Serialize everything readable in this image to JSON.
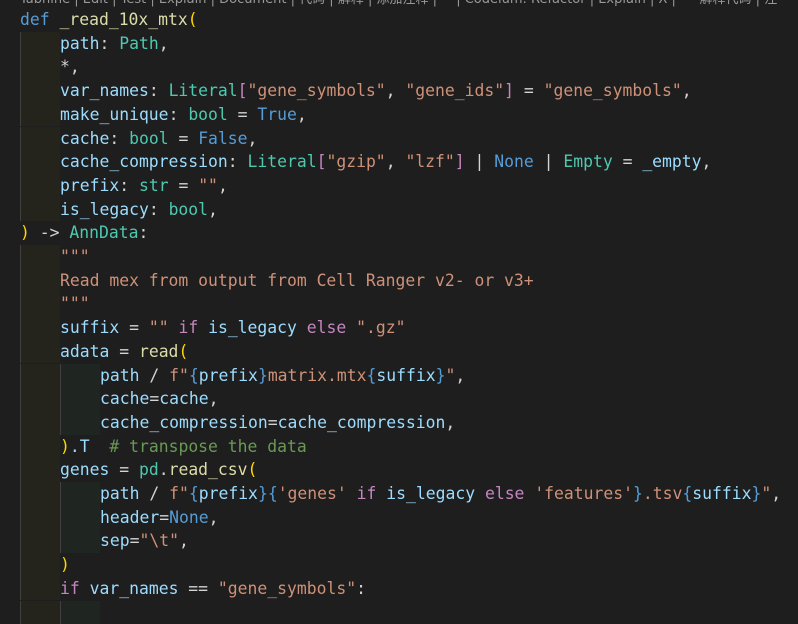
{
  "codelens": [
    "Tabnine",
    "Edit",
    "Test",
    "Explain",
    "Document",
    "代码",
    "解释",
    "添加注释",
    "^",
    "Codeium: Refactor",
    "Explain",
    "X",
    "***解释代码",
    "注"
  ],
  "colors": {
    "background": "#1e1e1e",
    "keyword": "#569cd6",
    "function": "#dcdcaa",
    "parameter": "#9cdcfe",
    "type": "#4ec9b0",
    "string": "#ce9178",
    "control": "#c586c0",
    "bracket": "#ffd700",
    "comment": "#6a9955"
  },
  "lines": [
    {
      "indent": 0,
      "tokens": [
        [
          "def",
          "kw"
        ],
        [
          " ",
          "plain"
        ],
        [
          "_read_10x_mtx",
          "fn"
        ],
        [
          "(",
          "bracket"
        ]
      ]
    },
    {
      "indent": 1,
      "tokens": [
        [
          "path",
          "param"
        ],
        [
          ": ",
          "plain"
        ],
        [
          "Path",
          "type"
        ],
        [
          ",",
          "plain"
        ]
      ]
    },
    {
      "indent": 1,
      "tokens": [
        [
          "*,",
          "plain"
        ]
      ]
    },
    {
      "indent": 1,
      "tokens": [
        [
          "var_names",
          "param"
        ],
        [
          ": ",
          "plain"
        ],
        [
          "Literal",
          "type"
        ],
        [
          "[",
          "ctrl"
        ],
        [
          "\"gene_symbols\"",
          "str"
        ],
        [
          ", ",
          "plain"
        ],
        [
          "\"gene_ids\"",
          "str"
        ],
        [
          "]",
          "ctrl"
        ],
        [
          " = ",
          "plain"
        ],
        [
          "\"gene_symbols\"",
          "str"
        ],
        [
          ",",
          "plain"
        ]
      ]
    },
    {
      "indent": 1,
      "tokens": [
        [
          "make_unique",
          "param"
        ],
        [
          ": ",
          "plain"
        ],
        [
          "bool",
          "type"
        ],
        [
          " = ",
          "plain"
        ],
        [
          "True",
          "kw"
        ],
        [
          ",",
          "plain"
        ]
      ]
    },
    {
      "indent": 1,
      "tokens": [
        [
          "cache",
          "param"
        ],
        [
          ": ",
          "plain"
        ],
        [
          "bool",
          "type"
        ],
        [
          " = ",
          "plain"
        ],
        [
          "False",
          "kw"
        ],
        [
          ",",
          "plain"
        ]
      ]
    },
    {
      "indent": 1,
      "tokens": [
        [
          "cache_compression",
          "param"
        ],
        [
          ": ",
          "plain"
        ],
        [
          "Literal",
          "type"
        ],
        [
          "[",
          "ctrl"
        ],
        [
          "\"gzip\"",
          "str"
        ],
        [
          ", ",
          "plain"
        ],
        [
          "\"lzf\"",
          "str"
        ],
        [
          "]",
          "ctrl"
        ],
        [
          " | ",
          "plain"
        ],
        [
          "None",
          "kw"
        ],
        [
          " | ",
          "plain"
        ],
        [
          "Empty",
          "type"
        ],
        [
          " = ",
          "plain"
        ],
        [
          "_empty",
          "param"
        ],
        [
          ",",
          "plain"
        ]
      ]
    },
    {
      "indent": 1,
      "tokens": [
        [
          "prefix",
          "param"
        ],
        [
          ": ",
          "plain"
        ],
        [
          "str",
          "type"
        ],
        [
          " = ",
          "plain"
        ],
        [
          "\"\"",
          "str"
        ],
        [
          ",",
          "plain"
        ]
      ]
    },
    {
      "indent": 1,
      "tokens": [
        [
          "is_legacy",
          "param"
        ],
        [
          ": ",
          "plain"
        ],
        [
          "bool",
          "type"
        ],
        [
          ",",
          "plain"
        ]
      ]
    },
    {
      "indent": 0,
      "tokens": [
        [
          ")",
          "bracket"
        ],
        [
          " -> ",
          "plain"
        ],
        [
          "AnnData",
          "type"
        ],
        [
          ":",
          "plain"
        ]
      ]
    },
    {
      "indent": 1,
      "tokens": [
        [
          "\"\"\"",
          "str"
        ]
      ]
    },
    {
      "indent": 1,
      "tokens": [
        [
          "Read mex from output from Cell Ranger v2- or v3+",
          "str"
        ]
      ]
    },
    {
      "indent": 1,
      "tokens": [
        [
          "\"\"\"",
          "str"
        ]
      ]
    },
    {
      "indent": 1,
      "tokens": [
        [
          "suffix",
          "param"
        ],
        [
          " = ",
          "plain"
        ],
        [
          "\"\"",
          "str"
        ],
        [
          " ",
          "plain"
        ],
        [
          "if",
          "ctrl"
        ],
        [
          " ",
          "plain"
        ],
        [
          "is_legacy",
          "param"
        ],
        [
          " ",
          "plain"
        ],
        [
          "else",
          "ctrl"
        ],
        [
          " ",
          "plain"
        ],
        [
          "\".gz\"",
          "str"
        ]
      ]
    },
    {
      "indent": 1,
      "tokens": [
        [
          "adata",
          "param"
        ],
        [
          " = ",
          "plain"
        ],
        [
          "read",
          "fn"
        ],
        [
          "(",
          "bracket"
        ]
      ]
    },
    {
      "indent": 2,
      "tokens": [
        [
          "path",
          "param"
        ],
        [
          " / ",
          "plain"
        ],
        [
          "f\"",
          "str"
        ],
        [
          "{",
          "kw"
        ],
        [
          "prefix",
          "param"
        ],
        [
          "}",
          "kw"
        ],
        [
          "matrix.mtx",
          "str"
        ],
        [
          "{",
          "kw"
        ],
        [
          "suffix",
          "param"
        ],
        [
          "}",
          "kw"
        ],
        [
          "\"",
          "str"
        ],
        [
          ",",
          "plain"
        ]
      ]
    },
    {
      "indent": 2,
      "tokens": [
        [
          "cache",
          "param"
        ],
        [
          "=",
          "plain"
        ],
        [
          "cache",
          "param"
        ],
        [
          ",",
          "plain"
        ]
      ]
    },
    {
      "indent": 2,
      "tokens": [
        [
          "cache_compression",
          "param"
        ],
        [
          "=",
          "plain"
        ],
        [
          "cache_compression",
          "param"
        ],
        [
          ",",
          "plain"
        ]
      ]
    },
    {
      "indent": 1,
      "tokens": [
        [
          ")",
          "bracket"
        ],
        [
          ".T",
          "param"
        ],
        [
          "  ",
          "plain"
        ],
        [
          "# transpose the data",
          "comment"
        ]
      ]
    },
    {
      "indent": 1,
      "tokens": [
        [
          "genes",
          "param"
        ],
        [
          " = ",
          "plain"
        ],
        [
          "pd",
          "type"
        ],
        [
          ".",
          "plain"
        ],
        [
          "read_csv",
          "fn"
        ],
        [
          "(",
          "bracket"
        ]
      ]
    },
    {
      "indent": 2,
      "tokens": [
        [
          "path",
          "param"
        ],
        [
          " / ",
          "plain"
        ],
        [
          "f\"",
          "str"
        ],
        [
          "{",
          "kw"
        ],
        [
          "prefix",
          "param"
        ],
        [
          "}",
          "kw"
        ],
        [
          "{",
          "kw"
        ],
        [
          "'genes'",
          "str"
        ],
        [
          " ",
          "plain"
        ],
        [
          "if",
          "ctrl"
        ],
        [
          " ",
          "plain"
        ],
        [
          "is_legacy",
          "param"
        ],
        [
          " ",
          "plain"
        ],
        [
          "else",
          "ctrl"
        ],
        [
          " ",
          "plain"
        ],
        [
          "'features'",
          "str"
        ],
        [
          "}",
          "kw"
        ],
        [
          ".tsv",
          "str"
        ],
        [
          "{",
          "kw"
        ],
        [
          "suffix",
          "param"
        ],
        [
          "}",
          "kw"
        ],
        [
          "\"",
          "str"
        ],
        [
          ",",
          "plain"
        ]
      ]
    },
    {
      "indent": 2,
      "tokens": [
        [
          "header",
          "param"
        ],
        [
          "=",
          "plain"
        ],
        [
          "None",
          "kw"
        ],
        [
          ",",
          "plain"
        ]
      ]
    },
    {
      "indent": 2,
      "tokens": [
        [
          "sep",
          "param"
        ],
        [
          "=",
          "plain"
        ],
        [
          "\"\\t\"",
          "str"
        ],
        [
          ",",
          "plain"
        ]
      ]
    },
    {
      "indent": 1,
      "tokens": [
        [
          ")",
          "bracket"
        ]
      ]
    },
    {
      "indent": 1,
      "tokens": [
        [
          "if",
          "ctrl"
        ],
        [
          " ",
          "plain"
        ],
        [
          "var_names",
          "param"
        ],
        [
          " == ",
          "plain"
        ],
        [
          "\"gene_symbols\"",
          "str"
        ],
        [
          ":",
          "plain"
        ]
      ]
    },
    {
      "indent": 2,
      "tokens": []
    }
  ]
}
